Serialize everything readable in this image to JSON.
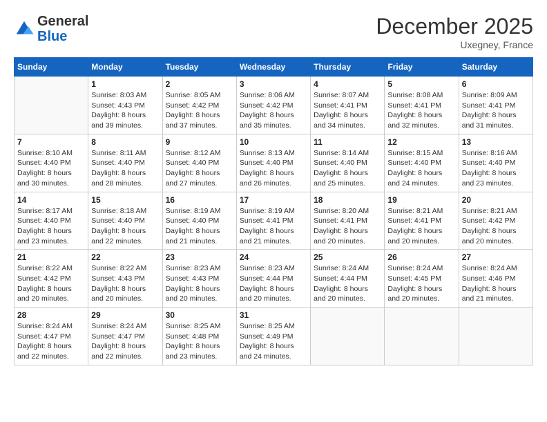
{
  "header": {
    "logo_general": "General",
    "logo_blue": "Blue",
    "month_title": "December 2025",
    "location": "Uxegney, France"
  },
  "calendar": {
    "days_of_week": [
      "Sunday",
      "Monday",
      "Tuesday",
      "Wednesday",
      "Thursday",
      "Friday",
      "Saturday"
    ],
    "weeks": [
      [
        {
          "day": "",
          "sunrise": "",
          "sunset": "",
          "daylight": ""
        },
        {
          "day": "1",
          "sunrise": "Sunrise: 8:03 AM",
          "sunset": "Sunset: 4:43 PM",
          "daylight": "Daylight: 8 hours and 39 minutes."
        },
        {
          "day": "2",
          "sunrise": "Sunrise: 8:05 AM",
          "sunset": "Sunset: 4:42 PM",
          "daylight": "Daylight: 8 hours and 37 minutes."
        },
        {
          "day": "3",
          "sunrise": "Sunrise: 8:06 AM",
          "sunset": "Sunset: 4:42 PM",
          "daylight": "Daylight: 8 hours and 35 minutes."
        },
        {
          "day": "4",
          "sunrise": "Sunrise: 8:07 AM",
          "sunset": "Sunset: 4:41 PM",
          "daylight": "Daylight: 8 hours and 34 minutes."
        },
        {
          "day": "5",
          "sunrise": "Sunrise: 8:08 AM",
          "sunset": "Sunset: 4:41 PM",
          "daylight": "Daylight: 8 hours and 32 minutes."
        },
        {
          "day": "6",
          "sunrise": "Sunrise: 8:09 AM",
          "sunset": "Sunset: 4:41 PM",
          "daylight": "Daylight: 8 hours and 31 minutes."
        }
      ],
      [
        {
          "day": "7",
          "sunrise": "Sunrise: 8:10 AM",
          "sunset": "Sunset: 4:40 PM",
          "daylight": "Daylight: 8 hours and 30 minutes."
        },
        {
          "day": "8",
          "sunrise": "Sunrise: 8:11 AM",
          "sunset": "Sunset: 4:40 PM",
          "daylight": "Daylight: 8 hours and 28 minutes."
        },
        {
          "day": "9",
          "sunrise": "Sunrise: 8:12 AM",
          "sunset": "Sunset: 4:40 PM",
          "daylight": "Daylight: 8 hours and 27 minutes."
        },
        {
          "day": "10",
          "sunrise": "Sunrise: 8:13 AM",
          "sunset": "Sunset: 4:40 PM",
          "daylight": "Daylight: 8 hours and 26 minutes."
        },
        {
          "day": "11",
          "sunrise": "Sunrise: 8:14 AM",
          "sunset": "Sunset: 4:40 PM",
          "daylight": "Daylight: 8 hours and 25 minutes."
        },
        {
          "day": "12",
          "sunrise": "Sunrise: 8:15 AM",
          "sunset": "Sunset: 4:40 PM",
          "daylight": "Daylight: 8 hours and 24 minutes."
        },
        {
          "day": "13",
          "sunrise": "Sunrise: 8:16 AM",
          "sunset": "Sunset: 4:40 PM",
          "daylight": "Daylight: 8 hours and 23 minutes."
        }
      ],
      [
        {
          "day": "14",
          "sunrise": "Sunrise: 8:17 AM",
          "sunset": "Sunset: 4:40 PM",
          "daylight": "Daylight: 8 hours and 23 minutes."
        },
        {
          "day": "15",
          "sunrise": "Sunrise: 8:18 AM",
          "sunset": "Sunset: 4:40 PM",
          "daylight": "Daylight: 8 hours and 22 minutes."
        },
        {
          "day": "16",
          "sunrise": "Sunrise: 8:19 AM",
          "sunset": "Sunset: 4:40 PM",
          "daylight": "Daylight: 8 hours and 21 minutes."
        },
        {
          "day": "17",
          "sunrise": "Sunrise: 8:19 AM",
          "sunset": "Sunset: 4:41 PM",
          "daylight": "Daylight: 8 hours and 21 minutes."
        },
        {
          "day": "18",
          "sunrise": "Sunrise: 8:20 AM",
          "sunset": "Sunset: 4:41 PM",
          "daylight": "Daylight: 8 hours and 20 minutes."
        },
        {
          "day": "19",
          "sunrise": "Sunrise: 8:21 AM",
          "sunset": "Sunset: 4:41 PM",
          "daylight": "Daylight: 8 hours and 20 minutes."
        },
        {
          "day": "20",
          "sunrise": "Sunrise: 8:21 AM",
          "sunset": "Sunset: 4:42 PM",
          "daylight": "Daylight: 8 hours and 20 minutes."
        }
      ],
      [
        {
          "day": "21",
          "sunrise": "Sunrise: 8:22 AM",
          "sunset": "Sunset: 4:42 PM",
          "daylight": "Daylight: 8 hours and 20 minutes."
        },
        {
          "day": "22",
          "sunrise": "Sunrise: 8:22 AM",
          "sunset": "Sunset: 4:43 PM",
          "daylight": "Daylight: 8 hours and 20 minutes."
        },
        {
          "day": "23",
          "sunrise": "Sunrise: 8:23 AM",
          "sunset": "Sunset: 4:43 PM",
          "daylight": "Daylight: 8 hours and 20 minutes."
        },
        {
          "day": "24",
          "sunrise": "Sunrise: 8:23 AM",
          "sunset": "Sunset: 4:44 PM",
          "daylight": "Daylight: 8 hours and 20 minutes."
        },
        {
          "day": "25",
          "sunrise": "Sunrise: 8:24 AM",
          "sunset": "Sunset: 4:44 PM",
          "daylight": "Daylight: 8 hours and 20 minutes."
        },
        {
          "day": "26",
          "sunrise": "Sunrise: 8:24 AM",
          "sunset": "Sunset: 4:45 PM",
          "daylight": "Daylight: 8 hours and 20 minutes."
        },
        {
          "day": "27",
          "sunrise": "Sunrise: 8:24 AM",
          "sunset": "Sunset: 4:46 PM",
          "daylight": "Daylight: 8 hours and 21 minutes."
        }
      ],
      [
        {
          "day": "28",
          "sunrise": "Sunrise: 8:24 AM",
          "sunset": "Sunset: 4:47 PM",
          "daylight": "Daylight: 8 hours and 22 minutes."
        },
        {
          "day": "29",
          "sunrise": "Sunrise: 8:24 AM",
          "sunset": "Sunset: 4:47 PM",
          "daylight": "Daylight: 8 hours and 22 minutes."
        },
        {
          "day": "30",
          "sunrise": "Sunrise: 8:25 AM",
          "sunset": "Sunset: 4:48 PM",
          "daylight": "Daylight: 8 hours and 23 minutes."
        },
        {
          "day": "31",
          "sunrise": "Sunrise: 8:25 AM",
          "sunset": "Sunset: 4:49 PM",
          "daylight": "Daylight: 8 hours and 24 minutes."
        },
        {
          "day": "",
          "sunrise": "",
          "sunset": "",
          "daylight": ""
        },
        {
          "day": "",
          "sunrise": "",
          "sunset": "",
          "daylight": ""
        },
        {
          "day": "",
          "sunrise": "",
          "sunset": "",
          "daylight": ""
        }
      ]
    ]
  }
}
